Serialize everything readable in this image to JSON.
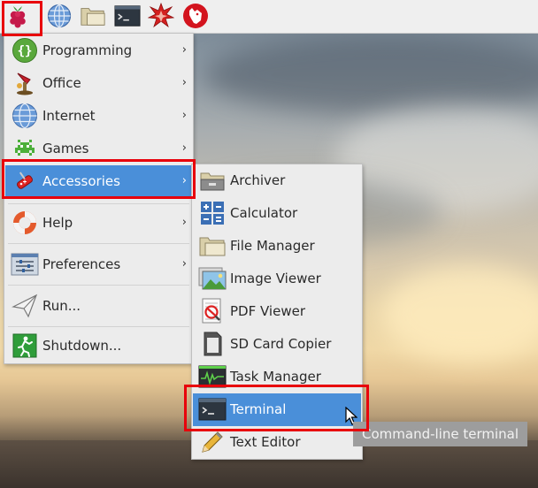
{
  "taskbar": {
    "icons": [
      "raspberry-menu-icon",
      "web-browser-icon",
      "file-manager-icon",
      "terminal-icon",
      "mathematica-icon",
      "wolfram-icon"
    ]
  },
  "main_menu": {
    "items": [
      {
        "label": "Programming",
        "icon": "programming-icon",
        "submenu": true
      },
      {
        "label": "Office",
        "icon": "office-icon",
        "submenu": true
      },
      {
        "label": "Internet",
        "icon": "internet-icon",
        "submenu": true
      },
      {
        "label": "Games",
        "icon": "games-icon",
        "submenu": true
      },
      {
        "label": "Accessories",
        "icon": "accessories-icon",
        "submenu": true,
        "highlighted": true
      },
      {
        "label": "Help",
        "icon": "help-icon",
        "submenu": true
      },
      {
        "label": "Preferences",
        "icon": "preferences-icon",
        "submenu": true
      },
      {
        "label": "Run...",
        "icon": "run-icon",
        "submenu": false
      },
      {
        "label": "Shutdown...",
        "icon": "shutdown-icon",
        "submenu": false
      }
    ],
    "arrow": "›"
  },
  "accessories_menu": {
    "items": [
      {
        "label": "Archiver",
        "icon": "archiver-icon"
      },
      {
        "label": "Calculator",
        "icon": "calculator-icon"
      },
      {
        "label": "File Manager",
        "icon": "folder-icon"
      },
      {
        "label": "Image Viewer",
        "icon": "image-viewer-icon"
      },
      {
        "label": "PDF Viewer",
        "icon": "pdf-viewer-icon"
      },
      {
        "label": "SD Card Copier",
        "icon": "sd-card-icon"
      },
      {
        "label": "Task Manager",
        "icon": "task-manager-icon"
      },
      {
        "label": "Terminal",
        "icon": "terminal-icon",
        "highlighted": true
      },
      {
        "label": "Text Editor",
        "icon": "text-editor-icon"
      }
    ]
  },
  "tooltip": {
    "text": "Command-line terminal"
  },
  "colors": {
    "highlight": "#4a8fd9",
    "annotation": "#e8000b",
    "menu_bg": "#ececec"
  }
}
